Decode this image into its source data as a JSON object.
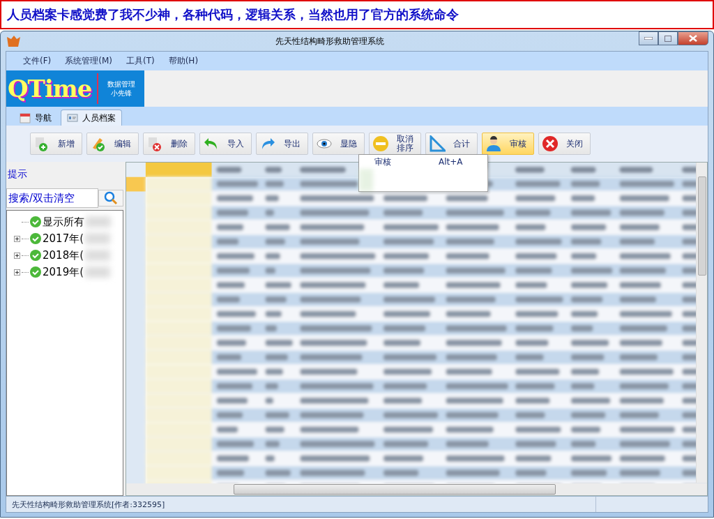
{
  "banner": {
    "text": "人员档案卡感觉费了我不少神，各种代码，逻辑关系，当然也用了官方的系统命令"
  },
  "window": {
    "title": "先天性结构畸形救助管理系统"
  },
  "menu": [
    "文件(F)",
    "系统管理(M)",
    "工具(T)",
    "帮助(H)"
  ],
  "logo": {
    "name": "QTime",
    "subtitle": "数据管理",
    "subtitle2": "小先锋"
  },
  "tabs": [
    {
      "label": "导航",
      "kind": "calendar",
      "selected": false
    },
    {
      "label": "人员档案",
      "kind": "card",
      "selected": true
    }
  ],
  "toolbar": [
    {
      "label": "新增",
      "kind": "add",
      "active": false
    },
    {
      "label": "编辑",
      "kind": "edit",
      "active": false
    },
    {
      "label": "删除",
      "kind": "delete",
      "active": false
    },
    {
      "label": "导入",
      "kind": "import",
      "active": false
    },
    {
      "label": "导出",
      "kind": "export",
      "active": false
    },
    {
      "label": "显隐",
      "kind": "eye",
      "active": false
    },
    {
      "label": "取消排序",
      "kind": "cancel",
      "active": false
    },
    {
      "label": "合计",
      "kind": "sum",
      "active": false
    },
    {
      "label": "审核",
      "kind": "review",
      "active": true
    },
    {
      "label": "关闭",
      "kind": "close",
      "active": false
    }
  ],
  "dropdown": [
    {
      "label": "审核",
      "shortcut": "Alt+A"
    }
  ],
  "sidebar": {
    "title": "提示",
    "search": {
      "placeholder": "搜索/双击清空"
    },
    "tree": [
      {
        "label": "显示所有",
        "expandable": false
      },
      {
        "label": "2017年(",
        "expandable": true
      },
      {
        "label": "2018年(",
        "expandable": true
      },
      {
        "label": "2019年(",
        "expandable": true
      }
    ]
  },
  "status_bar": {
    "text": "先天性结构畸形救助管理系统[作者:332595]"
  }
}
